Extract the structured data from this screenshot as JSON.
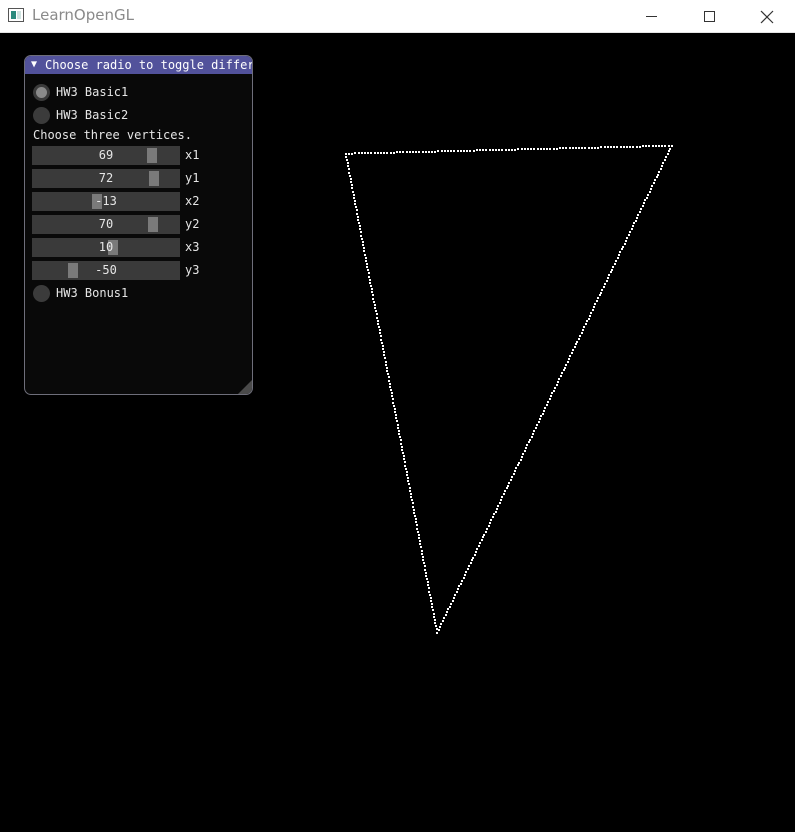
{
  "window": {
    "title": "LearnOpenGL"
  },
  "panel": {
    "title": "Choose radio to toggle differ",
    "radios": [
      {
        "label": "HW3 Basic1",
        "selected": true
      },
      {
        "label": "HW3 Basic2",
        "selected": false
      },
      {
        "label": "HW3 Bonus1",
        "selected": false
      }
    ],
    "hint": "Choose three vertices.",
    "sliders": [
      {
        "name": "x1",
        "display": "69",
        "value": 69,
        "min": -100,
        "max": 100
      },
      {
        "name": "y1",
        "display": "72",
        "value": 72,
        "min": -100,
        "max": 100
      },
      {
        "name": "x2",
        "display": "-13",
        "value": -13,
        "min": -100,
        "max": 100
      },
      {
        "name": "y2",
        "display": "70",
        "value": 70,
        "min": -100,
        "max": 100
      },
      {
        "name": "x3",
        "display": "10",
        "value": 10,
        "min": -100,
        "max": 100
      },
      {
        "name": "y3",
        "display": "-50",
        "value": -50,
        "min": -100,
        "max": 100
      }
    ]
  },
  "colors": {
    "background": "#000000",
    "triangle_edge": "#ffffff",
    "header": "#52529b"
  },
  "icons": [
    "app-icon",
    "minimize-icon",
    "maximize-icon",
    "close-icon",
    "collapse-arrow-icon",
    "resize-grip-icon"
  ]
}
